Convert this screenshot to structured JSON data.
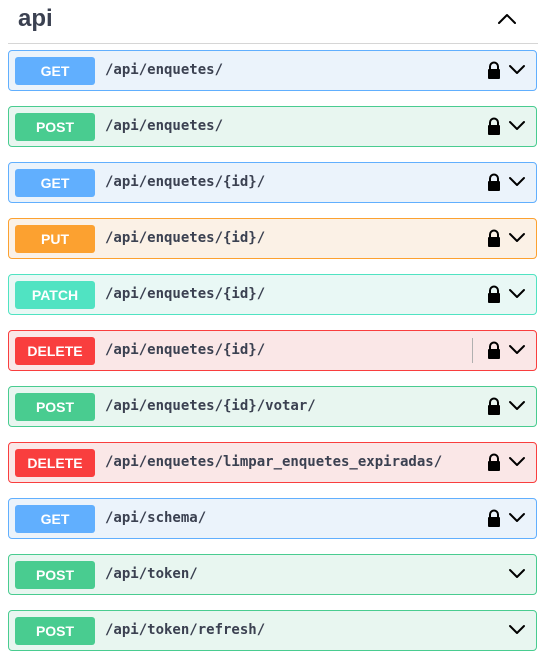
{
  "section": {
    "title": "api",
    "toggle_icon": "chevron-up-icon"
  },
  "operations": [
    {
      "method": "GET",
      "path": "/api/enquetes/",
      "locked": true,
      "variant": "get"
    },
    {
      "method": "POST",
      "path": "/api/enquetes/",
      "locked": true,
      "variant": "post"
    },
    {
      "method": "GET",
      "path": "/api/enquetes/{id}/",
      "locked": true,
      "variant": "get"
    },
    {
      "method": "PUT",
      "path": "/api/enquetes/{id}/",
      "locked": true,
      "variant": "put"
    },
    {
      "method": "PATCH",
      "path": "/api/enquetes/{id}/",
      "locked": true,
      "variant": "patch"
    },
    {
      "method": "DELETE",
      "path": "/api/enquetes/{id}/",
      "locked": true,
      "variant": "delete",
      "divider": true
    },
    {
      "method": "POST",
      "path": "/api/enquetes/{id}/votar/",
      "locked": true,
      "variant": "post"
    },
    {
      "method": "DELETE",
      "path": "/api/enquetes/limpar_enquetes_expiradas/",
      "locked": true,
      "variant": "delete"
    },
    {
      "method": "GET",
      "path": "/api/schema/",
      "locked": true,
      "variant": "get"
    },
    {
      "method": "POST",
      "path": "/api/token/",
      "locked": false,
      "variant": "post"
    },
    {
      "method": "POST",
      "path": "/api/token/refresh/",
      "locked": false,
      "variant": "post"
    }
  ],
  "colors": {
    "get": "#61affe",
    "post": "#49cc90",
    "put": "#fca130",
    "patch": "#50e3c2",
    "delete": "#f93e3e",
    "text": "#3b4151"
  }
}
